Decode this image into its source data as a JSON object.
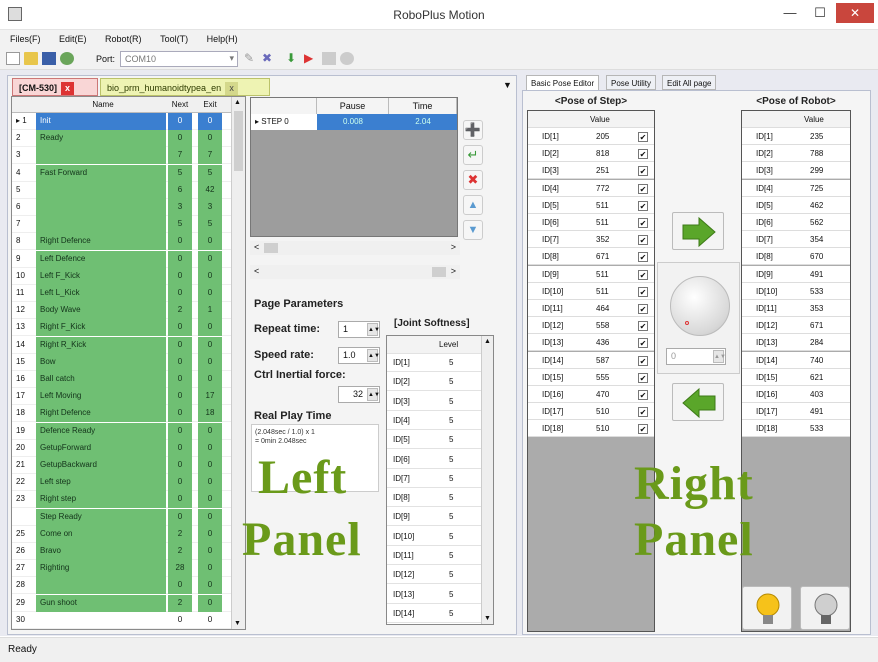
{
  "window": {
    "title": "RoboPlus Motion",
    "minimize": "—",
    "maximize": "☐",
    "close": "✕"
  },
  "menu": [
    "Files(F)",
    "Edit(E)",
    "Robot(R)",
    "Tool(T)",
    "Help(H)"
  ],
  "toolbar": {
    "port_label": "Port:",
    "port_value": "COM10"
  },
  "tabs": {
    "controller": "[CM-530]",
    "file": "bio_prm_humanoidtypea_en"
  },
  "step_table": {
    "headers": {
      "name": "Name",
      "next": "Next",
      "exit": "Exit"
    },
    "rows": [
      {
        "num": "1",
        "name": "Init",
        "next": "0",
        "exit": "0"
      },
      {
        "num": "2",
        "name": "Ready",
        "next": "0",
        "exit": "0"
      },
      {
        "num": "3",
        "name": "",
        "next": "7",
        "exit": "7"
      },
      {
        "num": "4",
        "name": "Fast Forward",
        "next": "5",
        "exit": "5"
      },
      {
        "num": "5",
        "name": "",
        "next": "6",
        "exit": "42"
      },
      {
        "num": "6",
        "name": "",
        "next": "3",
        "exit": "3"
      },
      {
        "num": "7",
        "name": "",
        "next": "5",
        "exit": "5"
      },
      {
        "num": "8",
        "name": "Right Defence",
        "next": "0",
        "exit": "0"
      },
      {
        "num": "9",
        "name": "Left Defence",
        "next": "0",
        "exit": "0"
      },
      {
        "num": "10",
        "name": "Left F_Kick",
        "next": "0",
        "exit": "0"
      },
      {
        "num": "11",
        "name": "Left L_Kick",
        "next": "0",
        "exit": "0"
      },
      {
        "num": "12",
        "name": "Body Wave",
        "next": "2",
        "exit": "1"
      },
      {
        "num": "13",
        "name": "Right F_Kick",
        "next": "0",
        "exit": "0"
      },
      {
        "num": "14",
        "name": "Right R_Kick",
        "next": "0",
        "exit": "0"
      },
      {
        "num": "15",
        "name": "Bow",
        "next": "0",
        "exit": "0"
      },
      {
        "num": "16",
        "name": "Ball catch",
        "next": "0",
        "exit": "0"
      },
      {
        "num": "17",
        "name": "Left Moving",
        "next": "0",
        "exit": "17"
      },
      {
        "num": "18",
        "name": "Right Defence",
        "next": "0",
        "exit": "18"
      },
      {
        "num": "19",
        "name": "Defence Ready",
        "next": "0",
        "exit": "0"
      },
      {
        "num": "20",
        "name": "GetupForward",
        "next": "0",
        "exit": "0"
      },
      {
        "num": "21",
        "name": "GetupBackward",
        "next": "0",
        "exit": "0"
      },
      {
        "num": "22",
        "name": "Left step",
        "next": "0",
        "exit": "0"
      },
      {
        "num": "23",
        "name": "Right step",
        "next": "0",
        "exit": "0"
      },
      {
        "num": "",
        "name": "Step Ready",
        "next": "0",
        "exit": "0"
      },
      {
        "num": "25",
        "name": "Come on",
        "next": "2",
        "exit": "0"
      },
      {
        "num": "26",
        "name": "Bravo",
        "next": "2",
        "exit": "0"
      },
      {
        "num": "27",
        "name": "Righting",
        "next": "28",
        "exit": "0"
      },
      {
        "num": "28",
        "name": "",
        "next": "0",
        "exit": "0"
      },
      {
        "num": "29",
        "name": "Gun shoot",
        "next": "2",
        "exit": "0"
      },
      {
        "num": "30",
        "name": "",
        "next": "0",
        "exit": "0"
      }
    ]
  },
  "pause_time": {
    "pause_header": "Pause",
    "time_header": "Time",
    "step": "STEP 0",
    "pause": "0.008",
    "time": "2.04"
  },
  "page_params": {
    "title": "Page Parameters",
    "repeat_label": "Repeat time:",
    "repeat_value": "1",
    "speed_label": "Speed rate:",
    "speed_value": "1.0",
    "ctrl_label": "Ctrl Inertial force:",
    "ctrl_value": "32",
    "realplay_label": "Real Play Time",
    "realplay_line1": "(2.048sec / 1.0) x 1",
    "realplay_line2": "= 0min 2.048sec"
  },
  "joint_softness": {
    "title": "[Joint Softness]",
    "level_header": "Level",
    "rows": [
      {
        "id": "ID[1]",
        "level": "5"
      },
      {
        "id": "ID[2]",
        "level": "5"
      },
      {
        "id": "ID[3]",
        "level": "5"
      },
      {
        "id": "ID[4]",
        "level": "5"
      },
      {
        "id": "ID[5]",
        "level": "5"
      },
      {
        "id": "ID[6]",
        "level": "5"
      },
      {
        "id": "ID[7]",
        "level": "5"
      },
      {
        "id": "ID[8]",
        "level": "5"
      },
      {
        "id": "ID[9]",
        "level": "5"
      },
      {
        "id": "ID[10]",
        "level": "5"
      },
      {
        "id": "ID[11]",
        "level": "5"
      },
      {
        "id": "ID[12]",
        "level": "5"
      },
      {
        "id": "ID[13]",
        "level": "5"
      },
      {
        "id": "ID[14]",
        "level": "5"
      }
    ]
  },
  "overlay": {
    "left1": "Left",
    "left2": "Panel",
    "right1": "Right",
    "right2": "Panel"
  },
  "right_tabs": [
    "Basic Pose Editor",
    "Pose Utility",
    "Edit All page"
  ],
  "pose_step": {
    "title": "<Pose of Step>",
    "value_header": "Value",
    "rows": [
      {
        "id": "ID[1]",
        "value": "205"
      },
      {
        "id": "ID[2]",
        "value": "818"
      },
      {
        "id": "ID[3]",
        "value": "251"
      },
      {
        "id": "ID[4]",
        "value": "772"
      },
      {
        "id": "ID[5]",
        "value": "511"
      },
      {
        "id": "ID[6]",
        "value": "511"
      },
      {
        "id": "ID[7]",
        "value": "352"
      },
      {
        "id": "ID[8]",
        "value": "671"
      },
      {
        "id": "ID[9]",
        "value": "511"
      },
      {
        "id": "ID[10]",
        "value": "511"
      },
      {
        "id": "ID[11]",
        "value": "464"
      },
      {
        "id": "ID[12]",
        "value": "558"
      },
      {
        "id": "ID[13]",
        "value": "436"
      },
      {
        "id": "ID[14]",
        "value": "587"
      },
      {
        "id": "ID[15]",
        "value": "555"
      },
      {
        "id": "ID[16]",
        "value": "470"
      },
      {
        "id": "ID[17]",
        "value": "510"
      },
      {
        "id": "ID[18]",
        "value": "510"
      }
    ]
  },
  "pose_robot": {
    "title": "<Pose of Robot>",
    "value_header": "Value",
    "rows": [
      {
        "id": "ID[1]",
        "value": "235"
      },
      {
        "id": "ID[2]",
        "value": "788"
      },
      {
        "id": "ID[3]",
        "value": "299"
      },
      {
        "id": "ID[4]",
        "value": "725"
      },
      {
        "id": "ID[5]",
        "value": "462"
      },
      {
        "id": "ID[6]",
        "value": "562"
      },
      {
        "id": "ID[7]",
        "value": "354"
      },
      {
        "id": "ID[8]",
        "value": "670"
      },
      {
        "id": "ID[9]",
        "value": "491"
      },
      {
        "id": "ID[10]",
        "value": "533"
      },
      {
        "id": "ID[11]",
        "value": "353"
      },
      {
        "id": "ID[12]",
        "value": "671"
      },
      {
        "id": "ID[13]",
        "value": "284"
      },
      {
        "id": "ID[14]",
        "value": "740"
      },
      {
        "id": "ID[15]",
        "value": "621"
      },
      {
        "id": "ID[16]",
        "value": "403"
      },
      {
        "id": "ID[17]",
        "value": "491"
      },
      {
        "id": "ID[18]",
        "value": "533"
      }
    ]
  },
  "dial": {
    "value": "0"
  },
  "status": {
    "text": "Ready"
  },
  "colors": {
    "green_rows": "#6fbf73",
    "selection": "#3b7fd0",
    "overlay_text": "#6a9a1a",
    "arrow": "#5aa62a",
    "close": "#c9463d"
  }
}
